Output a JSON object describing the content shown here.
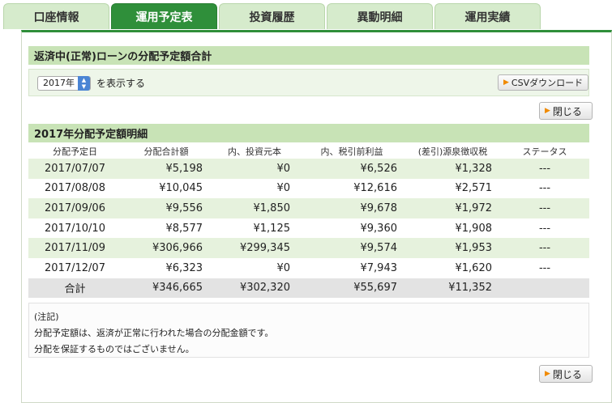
{
  "tabs": [
    {
      "label": "口座情報",
      "active": false
    },
    {
      "label": "運用予定表",
      "active": true
    },
    {
      "label": "投資履歴",
      "active": false
    },
    {
      "label": "異動明細",
      "active": false
    },
    {
      "label": "運用実績",
      "active": false
    }
  ],
  "summary": {
    "title": "返済中(正常)ローンの分配予定額合計",
    "year_select_value": "2017年",
    "year_select_suffix": "を表示する",
    "csv_button": "CSVダウンロード"
  },
  "close_label": "閉じる",
  "detail": {
    "title": "2017年分配予定額明細",
    "columns": [
      "分配予定日",
      "分配合計額",
      "内、投資元本",
      "内、税引前利益",
      "(差引)源泉徴収税",
      "ステータス"
    ],
    "rows": [
      [
        "2017/07/07",
        "¥5,198",
        "¥0",
        "¥6,526",
        "¥1,328",
        "---"
      ],
      [
        "2017/08/08",
        "¥10,045",
        "¥0",
        "¥12,616",
        "¥2,571",
        "---"
      ],
      [
        "2017/09/06",
        "¥9,556",
        "¥1,850",
        "¥9,678",
        "¥1,972",
        "---"
      ],
      [
        "2017/10/10",
        "¥8,577",
        "¥1,125",
        "¥9,360",
        "¥1,908",
        "---"
      ],
      [
        "2017/11/09",
        "¥306,966",
        "¥299,345",
        "¥9,574",
        "¥1,953",
        "---"
      ],
      [
        "2017/12/07",
        "¥6,323",
        "¥0",
        "¥7,943",
        "¥1,620",
        "---"
      ]
    ],
    "total": [
      "合計",
      "¥346,665",
      "¥302,320",
      "¥55,697",
      "¥11,352",
      ""
    ]
  },
  "note": {
    "heading": "(注記)",
    "line1": "分配予定額は、返済が正常に行われた場合の分配金額です。",
    "line2": "分配を保証するものではございません。"
  }
}
